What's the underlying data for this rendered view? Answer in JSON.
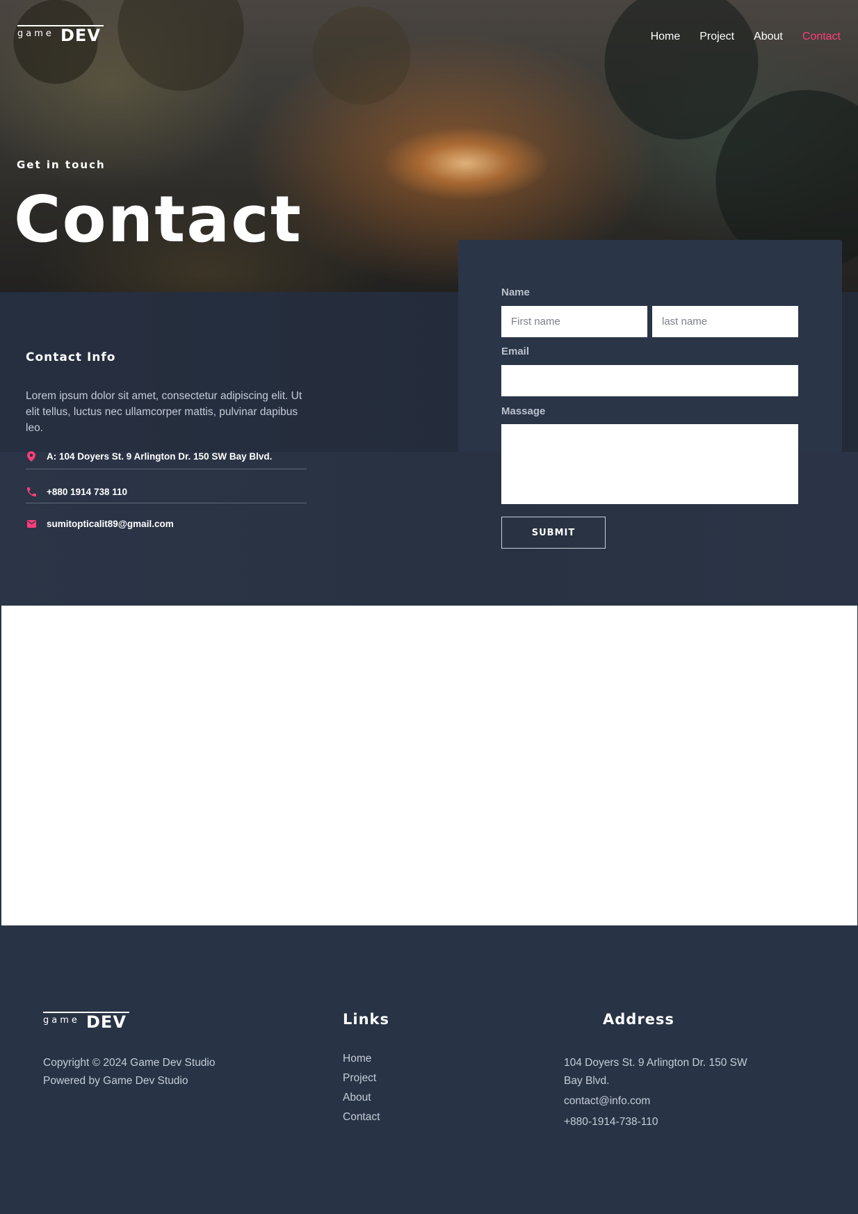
{
  "brand": {
    "logo_small": "game",
    "logo_big": "DEV"
  },
  "nav": {
    "items": [
      {
        "label": "Home"
      },
      {
        "label": "Project"
      },
      {
        "label": "About"
      },
      {
        "label": "Contact",
        "active": true
      }
    ],
    "active_color": "#ff3d7a"
  },
  "hero": {
    "kicker": "Get in touch",
    "title": "Contact"
  },
  "contact_info": {
    "heading": "Contact Info",
    "description": "Lorem ipsum dolor sit amet, consectetur adipiscing elit. Ut elit tellus, luctus nec ullamcorper mattis, pulvinar dapibus leo.",
    "address": "A: 104 Doyers St. 9 Arlington Dr. 150 SW Bay Blvd.",
    "phone": "+880 1914 738 110",
    "email": "sumitopticalit89@gmail.com",
    "icon_color": "#ff3d7a",
    "icons": [
      "map-pin-icon",
      "phone-icon",
      "mail-icon"
    ]
  },
  "form": {
    "name_label": "Name",
    "first_name_placeholder": "First name",
    "last_name_placeholder": "last name",
    "email_label": "Email",
    "email_value": "",
    "message_label": "Massage",
    "message_value": "",
    "submit_label": "SUBMIT"
  },
  "footer": {
    "logo_small": "game",
    "logo_big": "DEV",
    "copyright": "Copyright © 2024 Game Dev Studio",
    "powered": "Powered by Game Dev Studio",
    "links_heading": "Links",
    "links": [
      "Home",
      "Project",
      "About",
      "Contact"
    ],
    "address_heading": "Address",
    "address": "104 Doyers St. 9 Arlington Dr. 150 SW Bay Blvd.",
    "email": "contact@info.com",
    "phone": "+880-1914-738-110"
  }
}
